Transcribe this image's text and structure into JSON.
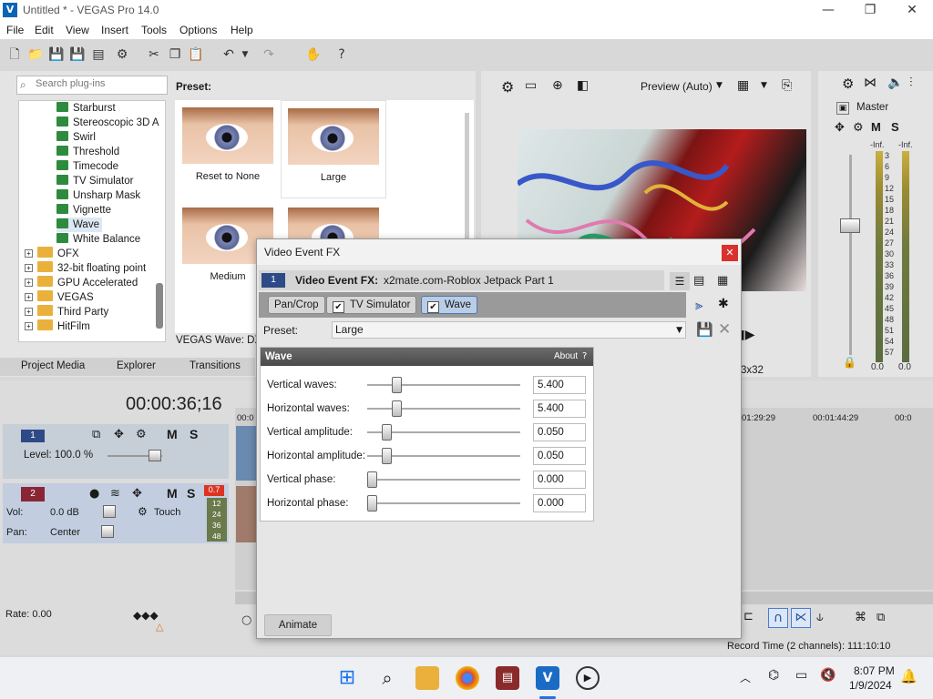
{
  "window": {
    "title": "Untitled * - VEGAS Pro 14.0",
    "logo": "V"
  },
  "menu": [
    "File",
    "Edit",
    "View",
    "Insert",
    "Tools",
    "Options",
    "Help"
  ],
  "plugins": {
    "search_placeholder": "Search plug-ins",
    "preset_label": "Preset:",
    "fx_items": [
      "Starburst",
      "Stereoscopic 3D A",
      "Swirl",
      "Threshold",
      "Timecode",
      "TV Simulator",
      "Unsharp Mask",
      "Vignette",
      "Wave",
      "White Balance"
    ],
    "folders": [
      "OFX",
      "32-bit floating point",
      "GPU Accelerated",
      "VEGAS",
      "Third Party",
      "HitFilm"
    ],
    "thumbnails": [
      "Reset to None",
      "Large",
      "Medium",
      ""
    ],
    "status_text": "VEGAS Wave: DXT"
  },
  "tabs": [
    "Project Media",
    "Explorer",
    "Transitions"
  ],
  "preview": {
    "mode": "Preview (Auto)",
    "info": "3x32"
  },
  "master": {
    "label": "Master",
    "meter_top": "-Inf.",
    "meter_scale": [
      "3",
      "6",
      "9",
      "12",
      "15",
      "18",
      "21",
      "24",
      "27",
      "30",
      "33",
      "36",
      "39",
      "42",
      "45",
      "48",
      "51",
      "54",
      "57"
    ],
    "readout_l": "0.0",
    "readout_r": "0.0"
  },
  "timeline": {
    "timecode": "00:00:36;16",
    "ruler": [
      "00:0",
      "01:29:29",
      "00:01:44:29",
      "00:0"
    ],
    "track1": {
      "num": "1",
      "level": "Level: 100.0 %"
    },
    "track2": {
      "num": "2",
      "vol": "Vol:",
      "vol_val": "0.0 dB",
      "pan": "Pan:",
      "pan_val": "Center",
      "mode": "Touch",
      "peak": "0.7",
      "db_marks": [
        "12",
        "24",
        "36",
        "48"
      ]
    },
    "rate": "Rate: 0.00",
    "record_time": "Record Time (2 channels): 111:10:10"
  },
  "dialog": {
    "title": "Video Event FX",
    "header_label": "Video Event FX:",
    "event_name": "x2mate.com-Roblox Jetpack Part 1",
    "event_num": "1",
    "chain": [
      "Pan/Crop",
      "TV Simulator",
      "Wave"
    ],
    "preset_label": "Preset:",
    "preset_value": "Large",
    "panel_title": "Wave",
    "about": "About",
    "params": [
      {
        "label": "Vertical waves:",
        "value": "5.400",
        "level": 0.17
      },
      {
        "label": "Horizontal waves:",
        "value": "5.400",
        "level": 0.17
      },
      {
        "label": "Vertical amplitude:",
        "value": "0.050",
        "level": 0.1
      },
      {
        "label": "Horizontal amplitude:",
        "value": "0.050",
        "level": 0.1
      },
      {
        "label": "Vertical phase:",
        "value": "0.000",
        "level": 0
      },
      {
        "label": "Horizontal phase:",
        "value": "0.000",
        "level": 0
      }
    ],
    "animate": "Animate"
  },
  "taskbar": {
    "time": "8:07 PM",
    "date": "1/9/2024"
  }
}
